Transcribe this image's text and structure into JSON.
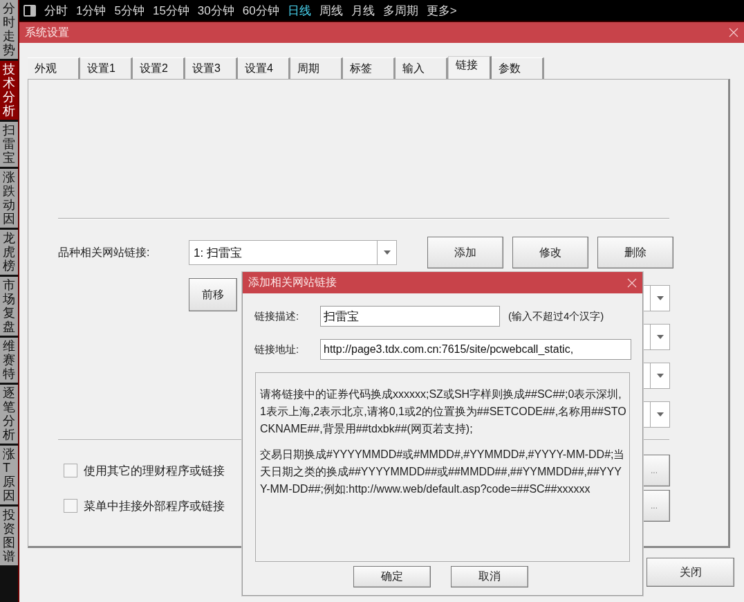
{
  "sidebar": {
    "items": [
      {
        "label": "分时走势",
        "selected": false
      },
      {
        "label": "技术分析",
        "selected": true
      },
      {
        "label": "扫雷宝",
        "selected": false
      },
      {
        "label": "涨跌动因",
        "selected": false
      },
      {
        "label": "龙虎榜",
        "selected": false
      },
      {
        "label": "市场复盘",
        "selected": false
      },
      {
        "label": "维赛特",
        "selected": false
      },
      {
        "label": "逐笔分析",
        "selected": false
      },
      {
        "label": "涨T原因",
        "selected": false
      },
      {
        "label": "投资图谱",
        "selected": false
      }
    ]
  },
  "toolbar": {
    "periods": [
      {
        "label": "分时",
        "selected": false
      },
      {
        "label": "1分钟",
        "selected": false
      },
      {
        "label": "5分钟",
        "selected": false
      },
      {
        "label": "15分钟",
        "selected": false
      },
      {
        "label": "30分钟",
        "selected": false
      },
      {
        "label": "60分钟",
        "selected": false
      },
      {
        "label": "日线",
        "selected": true
      },
      {
        "label": "周线",
        "selected": false
      },
      {
        "label": "月线",
        "selected": false
      },
      {
        "label": "多周期",
        "selected": false
      },
      {
        "label": "更多>",
        "selected": false
      }
    ]
  },
  "dialog": {
    "title": "系统设置",
    "tabs": [
      {
        "label": "外观",
        "selected": false
      },
      {
        "label": "设置1",
        "selected": false
      },
      {
        "label": "设置2",
        "selected": false
      },
      {
        "label": "设置3",
        "selected": false
      },
      {
        "label": "设置4",
        "selected": false
      },
      {
        "label": "周期",
        "selected": false
      },
      {
        "label": "标签",
        "selected": false
      },
      {
        "label": "输入",
        "selected": false
      },
      {
        "label": "链接",
        "selected": true
      },
      {
        "label": "参数",
        "selected": false
      }
    ],
    "site_link": {
      "label": "品种相关网站链接:",
      "value": "1: 扫雷宝"
    },
    "link_buttons": [
      "添加",
      "修改",
      "删除"
    ],
    "move_button": "前移",
    "side_fields": [
      {
        "kind": "dropdown"
      },
      {
        "kind": "dropdown"
      },
      {
        "kind": "dropdown"
      },
      {
        "kind": "dropdown"
      }
    ],
    "options": [
      {
        "label": "使用其它的理财程序或链接",
        "checked": false,
        "button": "..."
      },
      {
        "label": "菜单中挂接外部程序或链接",
        "checked": false,
        "button": "..."
      }
    ],
    "footer_button": "关闭"
  },
  "add_link_dialog": {
    "title": "添加相关网站链接",
    "description": {
      "label": "链接描述:",
      "value": "扫雷宝",
      "hint": "(输入不超过4个汉字)"
    },
    "address": {
      "label": "链接地址:",
      "value": "http://page3.tdx.com.cn:7615/site/pcwebcall_static,"
    },
    "help": [
      "请将链接中的证券代码换成xxxxxx;SZ或SH字样则换成##SC##;0表示深圳,1表示上海,2表示北京,请将0,1或2的位置换为##SETCODE##,名称用##STOCKNAME##,背景用##tdxbk##(网页若支持);",
      "交易日期换成#YYYYMMDD#或#MMDD#,#YYMMDD#,#YYYY-MM-DD#;当天日期之类的换成##YYYYMMDD##或##MMDD##,##YYMMDD##,##YYYY-MM-DD##;例如:http://www.web/default.asp?code=##SC##xxxxxx"
    ],
    "buttons": [
      "确定",
      "取消"
    ]
  }
}
